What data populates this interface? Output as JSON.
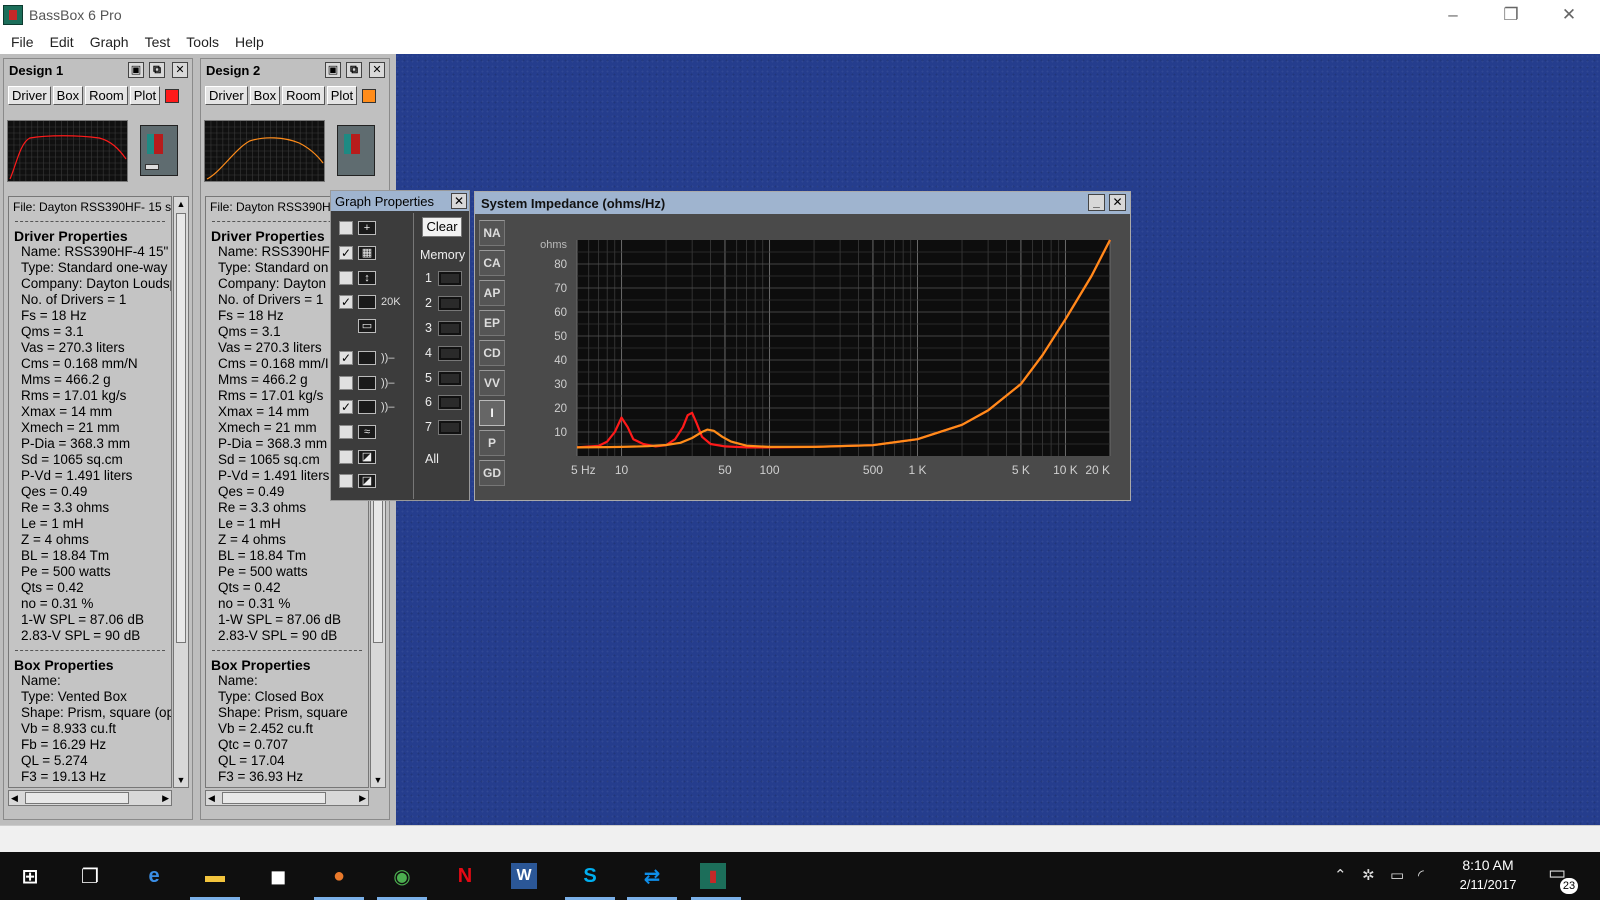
{
  "app": {
    "title": "BassBox 6 Pro",
    "minimize": "–",
    "restore": "❐",
    "close": "✕"
  },
  "menu": [
    "File",
    "Edit",
    "Graph",
    "Test",
    "Tools",
    "Help"
  ],
  "designs": [
    {
      "title": "Design 1",
      "tabs": [
        "Driver",
        "Box",
        "Room",
        "Plot"
      ],
      "plot_color": "#ff1a1a",
      "file": "File: Dayton RSS390HF- 15 s",
      "driver_heading": "Driver Properties",
      "driver": [
        "Name: RSS390HF-4 15\"",
        "Type: Standard one-way ",
        "Company: Dayton Loudsp",
        "No. of Drivers = 1",
        "Fs = 18 Hz",
        "Qms = 3.1",
        "Vas = 270.3 liters",
        "Cms = 0.168 mm/N",
        "Mms = 466.2 g",
        "Rms = 17.01 kg/s",
        "Xmax = 14 mm",
        "Xmech = 21 mm",
        "P-Dia = 368.3 mm",
        "Sd = 1065 sq.cm",
        "P-Vd = 1.491 liters",
        "Qes = 0.49",
        "Re = 3.3 ohms",
        "Le = 1 mH",
        "Z = 4 ohms",
        "BL = 18.84 Tm",
        "Pe = 500 watts",
        "Qts = 0.42",
        "no = 0.31 %",
        "1-W SPL = 87.06 dB",
        "2.83-V SPL = 90 dB"
      ],
      "box_heading": "Box Properties",
      "box": [
        "Name:",
        "Type: Vented Box",
        "Shape: Prism, square (opt",
        "Vb = 8.933 cu.ft",
        "Fb = 16.29 Hz",
        "QL = 5.274",
        "F3 = 19.13 Hz"
      ]
    },
    {
      "title": "Design 2",
      "tabs": [
        "Driver",
        "Box",
        "Room",
        "Plot"
      ],
      "plot_color": "#ff8c1a",
      "file": "File: Dayton RSS390H",
      "driver_heading": "Driver Properties",
      "driver": [
        "Name: RSS390HF",
        "Type: Standard on",
        "Company: Dayton I",
        "No. of Drivers = 1",
        "Fs = 18 Hz",
        "Qms = 3.1",
        "Vas = 270.3 liters",
        "Cms = 0.168 mm/I",
        "Mms = 466.2 g",
        "Rms = 17.01 kg/s",
        "Xmax = 14 mm",
        "Xmech = 21 mm",
        "P-Dia = 368.3 mm",
        "Sd = 1065 sq.cm",
        "P-Vd = 1.491 liters",
        "Qes = 0.49",
        "Re = 3.3 ohms",
        "Le = 1 mH",
        "Z = 4 ohms",
        "BL = 18.84 Tm",
        "Pe = 500 watts",
        "Qts = 0.42",
        "no = 0.31 %",
        "1-W SPL = 87.06 dB",
        "2.83-V SPL = 90 dB"
      ],
      "box_heading": "Box Properties",
      "box": [
        "Name:",
        "Type: Closed Box",
        "Shape: Prism, square",
        "Vb = 2.452 cu.ft",
        "Qtc = 0.707",
        "QL = 17.04",
        "F3 = 36.93 Hz"
      ]
    }
  ],
  "graph_properties": {
    "title": "Graph Properties",
    "clear_label": "Clear",
    "memory_label": "Memory",
    "memory_slots": [
      "1",
      "2",
      "3",
      "4",
      "5",
      "6",
      "7"
    ],
    "all_label": "All",
    "checks": [
      {
        "checked": false,
        "icon": "crosshair-icon",
        "glyph": "+"
      },
      {
        "checked": true,
        "icon": "grid-icon",
        "glyph": "▦"
      },
      {
        "checked": false,
        "icon": "scale-icon",
        "glyph": "↕"
      },
      {
        "checked": true,
        "icon": "range-20k-icon",
        "glyph": "20K"
      },
      {
        "checked": null,
        "icon": "display-icon",
        "glyph": "▭"
      },
      {
        "checked": true,
        "icon": "speaker-sound-icon",
        "glyph": "))–"
      },
      {
        "checked": false,
        "icon": "port-sound-icon",
        "glyph": "))–"
      },
      {
        "checked": true,
        "icon": "room-sound-icon",
        "glyph": "))–"
      },
      {
        "checked": false,
        "icon": "wave-speaker-icon",
        "glyph": "≈"
      },
      {
        "checked": false,
        "icon": "speaker-meter-icon",
        "glyph": "◪"
      },
      {
        "checked": false,
        "icon": "box-meter-icon",
        "glyph": "◪"
      }
    ]
  },
  "impedance_window": {
    "title": "System Impedance (ohms/Hz)",
    "side_buttons": [
      "NA",
      "CA",
      "AP",
      "EP",
      "CD",
      "VV",
      "I",
      "P",
      "GD"
    ],
    "active_side": "I"
  },
  "chart_data": {
    "type": "line",
    "title": "System Impedance (ohms/Hz)",
    "ylabel": "ohms",
    "xlabel": "",
    "x_scale": "log",
    "xlim": [
      5,
      20000
    ],
    "ylim": [
      0,
      90
    ],
    "y_ticks": [
      10,
      20,
      30,
      40,
      50,
      60,
      70,
      80
    ],
    "x_tick_labels": [
      {
        "freq": 5,
        "label": "5 Hz"
      },
      {
        "freq": 10,
        "label": "10"
      },
      {
        "freq": 50,
        "label": "50"
      },
      {
        "freq": 100,
        "label": "100"
      },
      {
        "freq": 500,
        "label": "500"
      },
      {
        "freq": 1000,
        "label": "1 K"
      },
      {
        "freq": 5000,
        "label": "5 K"
      },
      {
        "freq": 10000,
        "label": "10 K"
      },
      {
        "freq": 20000,
        "label": "20 K"
      }
    ],
    "grid": true,
    "series": [
      {
        "color": "#ff1a1a",
        "points": [
          [
            5,
            3.6
          ],
          [
            7,
            4.2
          ],
          [
            8,
            6
          ],
          [
            9,
            10
          ],
          [
            10,
            16
          ],
          [
            11,
            12
          ],
          [
            12,
            7
          ],
          [
            14,
            5
          ],
          [
            17,
            4
          ],
          [
            20,
            4.5
          ],
          [
            23,
            7
          ],
          [
            26,
            12
          ],
          [
            28,
            17
          ],
          [
            30,
            18
          ],
          [
            32,
            14
          ],
          [
            35,
            8
          ],
          [
            40,
            5
          ],
          [
            50,
            4
          ],
          [
            70,
            3.6
          ],
          [
            100,
            3.6
          ],
          [
            200,
            3.8
          ],
          [
            500,
            4.5
          ],
          [
            1000,
            7
          ],
          [
            2000,
            13
          ],
          [
            3000,
            19
          ],
          [
            5000,
            30
          ],
          [
            7000,
            42
          ],
          [
            10000,
            57
          ],
          [
            15000,
            75
          ],
          [
            20000,
            90
          ]
        ]
      },
      {
        "color": "#ff8c1a",
        "points": [
          [
            5,
            3.6
          ],
          [
            8,
            3.7
          ],
          [
            10,
            3.8
          ],
          [
            15,
            4.1
          ],
          [
            20,
            4.6
          ],
          [
            25,
            5.5
          ],
          [
            30,
            7.5
          ],
          [
            35,
            10
          ],
          [
            38,
            11
          ],
          [
            42,
            10.5
          ],
          [
            48,
            8
          ],
          [
            55,
            6
          ],
          [
            70,
            4.3
          ],
          [
            100,
            3.8
          ],
          [
            200,
            3.8
          ],
          [
            500,
            4.5
          ],
          [
            1000,
            7
          ],
          [
            2000,
            13
          ],
          [
            3000,
            19
          ],
          [
            5000,
            30
          ],
          [
            7000,
            42
          ],
          [
            10000,
            57
          ],
          [
            15000,
            75
          ],
          [
            20000,
            90
          ]
        ]
      }
    ]
  },
  "status_bar": "",
  "taskbar": {
    "apps": [
      {
        "name": "start-icon",
        "glyph": "⊞",
        "color": "#ffffff"
      },
      {
        "name": "task-view-icon",
        "glyph": "❐",
        "color": "#ffffff"
      },
      {
        "name": "edge-icon",
        "glyph": "e",
        "color": "#3a8ee6"
      },
      {
        "name": "file-explorer-icon",
        "glyph": "▬",
        "color": "#f2c43d"
      },
      {
        "name": "store-icon",
        "glyph": "◼",
        "color": "#ffffff"
      },
      {
        "name": "firefox-icon",
        "glyph": "●",
        "color": "#e8792b"
      },
      {
        "name": "chrome-icon",
        "glyph": "◉",
        "color": "#4caf50"
      },
      {
        "name": "netflix-icon",
        "glyph": "N",
        "color": "#e50914"
      },
      {
        "name": "word-icon",
        "glyph": "W",
        "color": "#2b5797"
      },
      {
        "name": "skype-icon",
        "glyph": "S",
        "color": "#00aff0"
      },
      {
        "name": "teamviewer-icon",
        "glyph": "⇄",
        "color": "#0e8ee9"
      },
      {
        "name": "bassbox-icon",
        "glyph": "▮",
        "color": "#1c6e5a"
      }
    ],
    "time": "8:10 AM",
    "date": "2/11/2017",
    "notification_count": "23"
  }
}
